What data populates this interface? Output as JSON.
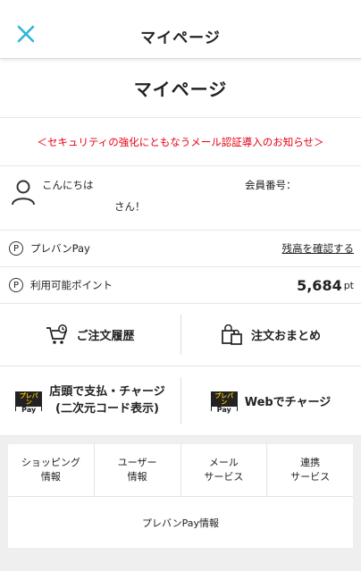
{
  "header": {
    "title": "マイページ"
  },
  "page": {
    "title": "マイページ"
  },
  "notice": {
    "text": "＜セキュリティの強化にともなうメール認証導入のお知らせ＞"
  },
  "user": {
    "greeting": "こんにちは",
    "member_label": "会員番号：",
    "san": "さん！"
  },
  "prepay": {
    "label": "プレバンPay",
    "link": "残高を確認する"
  },
  "points": {
    "label": "利用可能ポイント",
    "value": "5,684",
    "unit": "pt"
  },
  "actions": {
    "history": "ご注文履歴",
    "bundle": "注文おまとめ"
  },
  "pay": {
    "store_line1": "店頭で支払・チャージ",
    "store_line2": "(二次元コード表示)",
    "web": "Webでチャージ",
    "logo_top": "プレバン",
    "logo_bottom": "Pay"
  },
  "services": [
    {
      "line1": "ショッピング",
      "line2": "情報"
    },
    {
      "line1": "ユーザー",
      "line2": "情報"
    },
    {
      "line1": "メール",
      "line2": "サービス"
    },
    {
      "line1": "連携",
      "line2": "サービス"
    }
  ],
  "prepay_info": "プレバンPay情報",
  "colors": {
    "accent": "#2fb6d8",
    "alert": "#e60012",
    "logo_yellow": "#f5c400"
  }
}
